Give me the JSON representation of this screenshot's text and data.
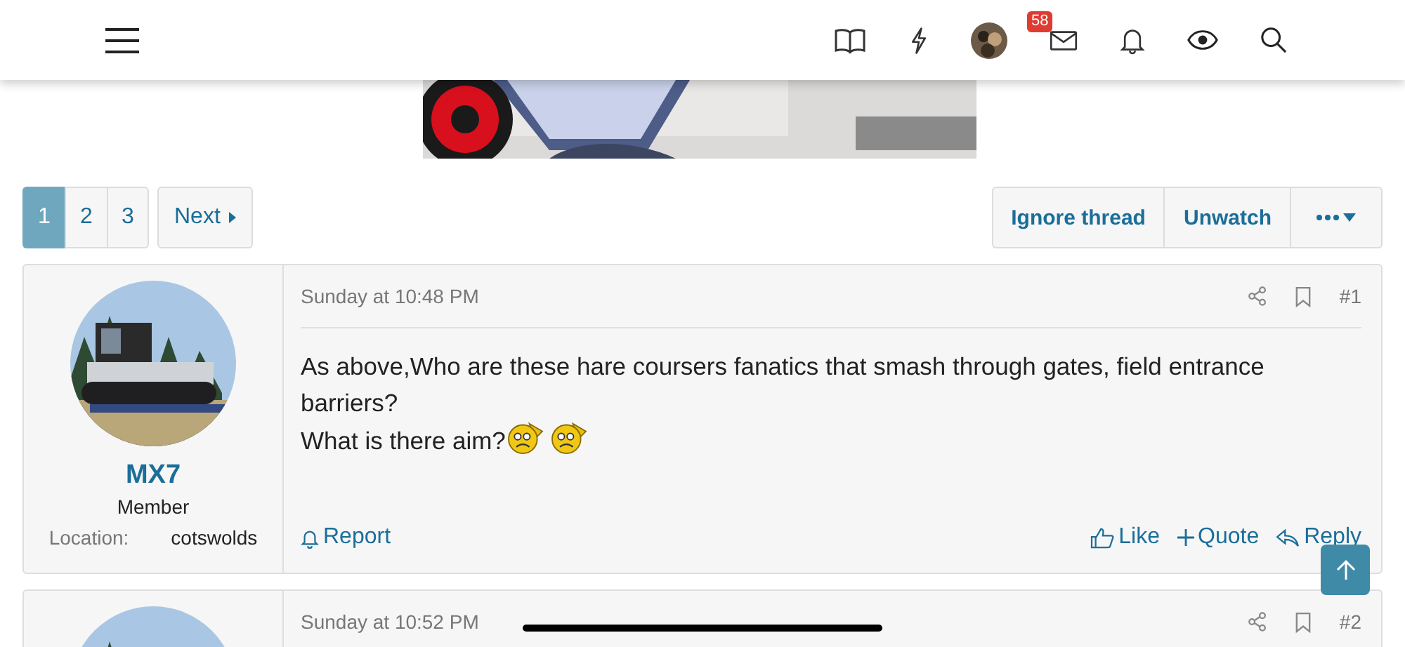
{
  "header": {
    "notification_count": "58"
  },
  "pagination": {
    "pages": [
      {
        "label": "1",
        "selected": true
      },
      {
        "label": "2",
        "selected": false
      },
      {
        "label": "3",
        "selected": false
      }
    ],
    "next": "Next"
  },
  "thread_actions": [
    "Ignore thread",
    "Unwatch"
  ],
  "posts": [
    {
      "author": "MX7",
      "role": "Member",
      "location_label": "Location:",
      "location": "cotswolds",
      "date": "Sunday at 10:48 PM",
      "number": "#1",
      "body": [
        "As above,Who are these hare coursers fanatics that smash through gates, field entrance barriers?",
        "What is there aim?"
      ],
      "emojis": [
        {
          "kind": "sad"
        },
        {
          "kind": "sad"
        }
      ],
      "actions": {
        "report": "Report",
        "like": "Like",
        "quote": "Quote",
        "reply": "Reply"
      }
    },
    {
      "date": "Sunday at 10:52 PM",
      "number": "#2"
    }
  ]
}
